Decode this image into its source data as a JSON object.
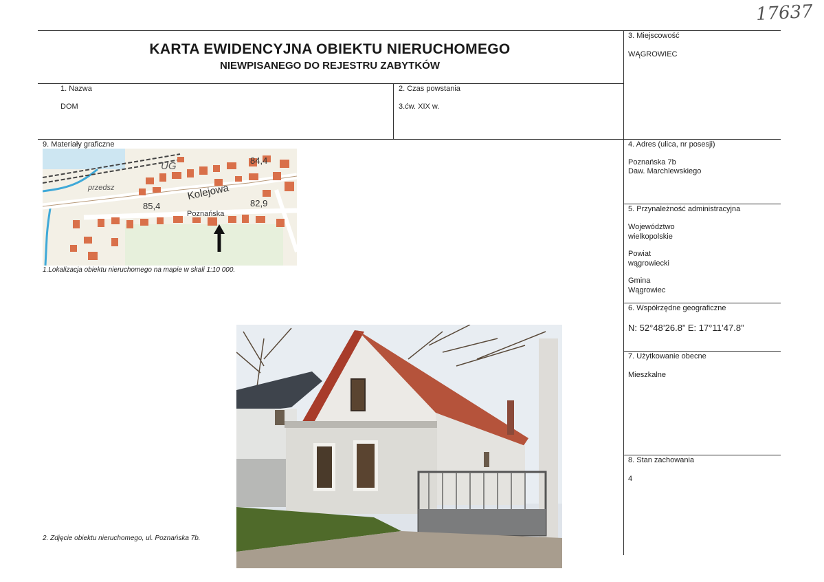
{
  "doc_number": "17637",
  "title": {
    "main": "KARTA EWIDENCYJNA OBIEKTU NIERUCHOMEGO",
    "sub": "NIEWPISANEGO DO REJESTRU ZABYTKÓW"
  },
  "fields": {
    "name": {
      "label": "1.     Nazwa",
      "value": "DOM"
    },
    "date": {
      "label": "2. Czas powstania",
      "value": "3.ćw. XIX w."
    },
    "locality": {
      "label": "3. Miejscowość",
      "value": "WĄGROWIEC"
    },
    "address": {
      "label": "4. Adres (ulica, nr posesji)",
      "line1": "Poznańska 7b",
      "line2": "Daw. Marchlewskiego"
    },
    "admin": {
      "label": "5. Przynależność administracyjna",
      "voivodeship_label": "Województwo",
      "voivodeship": "wielkopolskie",
      "county_label": "Powiat",
      "county": "wągrowiecki",
      "commune_label": "Gmina",
      "commune": "Wągrowiec"
    },
    "coords": {
      "label": "6. Współrzędne geograficzne",
      "value": "N: 52°48’26.8”  E: 17°11’47.8”"
    },
    "usage": {
      "label": "7. Użytkowanie obecne",
      "value": "Mieszkalne"
    },
    "condition": {
      "label": "8. Stan zachowania",
      "value": "4"
    },
    "graphics": {
      "label": "9. Materiały graficzne"
    }
  },
  "map": {
    "caption": "1.Lokalizacja obiektu nieruchomego na mapie w skali 1:10 000.",
    "labels": {
      "ug": "UG",
      "elev1": "84,4",
      "elev2": "85,4",
      "elev3": "82,9",
      "street1": "Kolejowa",
      "street2": "Poznańska",
      "street3": "przedsz"
    }
  },
  "photo": {
    "caption": "2. Zdjęcie obiektu nieruchomego, ul. Poznańska 7b."
  },
  "colors": {
    "lines": "#333333",
    "map_buildings": "#d9704a",
    "map_road": "#ffffff",
    "map_water": "#3fa9d8"
  }
}
